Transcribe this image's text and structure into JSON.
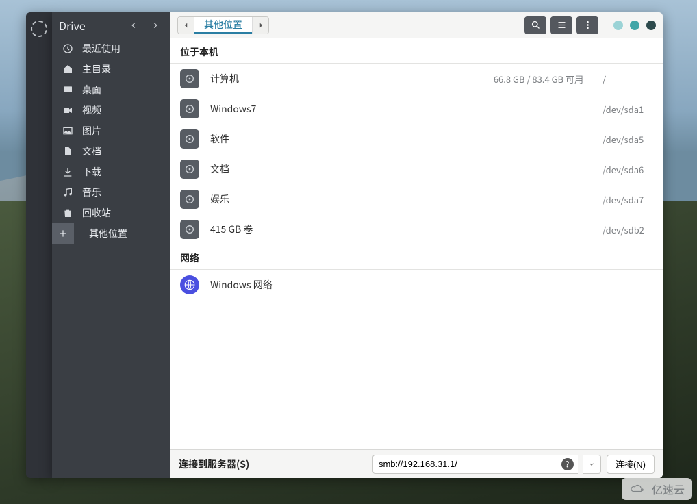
{
  "header": {
    "title": "Drive"
  },
  "path": {
    "current": "其他位置"
  },
  "sidebar": {
    "items": [
      {
        "label": "最近使用",
        "icon": "clock-icon"
      },
      {
        "label": "主目录",
        "icon": "home-icon"
      },
      {
        "label": "桌面",
        "icon": "desktop-icon"
      },
      {
        "label": "视频",
        "icon": "video-icon"
      },
      {
        "label": "图片",
        "icon": "image-icon"
      },
      {
        "label": "文档",
        "icon": "document-icon"
      },
      {
        "label": "下载",
        "icon": "download-icon"
      },
      {
        "label": "音乐",
        "icon": "music-icon"
      },
      {
        "label": "回收站",
        "icon": "trash-icon"
      }
    ],
    "other_label": "其他位置"
  },
  "sections": {
    "local_header": "位于本机",
    "network_header": "网络"
  },
  "volumes": [
    {
      "name": "计算机",
      "meta": "66.8 GB / 83.4 GB 可用",
      "path": "/"
    },
    {
      "name": "Windows7",
      "meta": "",
      "path": "/dev/sda1"
    },
    {
      "name": "软件",
      "meta": "",
      "path": "/dev/sda5"
    },
    {
      "name": "文档",
      "meta": "",
      "path": "/dev/sda6"
    },
    {
      "name": "娱乐",
      "meta": "",
      "path": "/dev/sda7"
    },
    {
      "name": "415 GB 卷",
      "meta": "",
      "path": "/dev/sdb2"
    }
  ],
  "network": [
    {
      "name": "Windows 网络"
    }
  ],
  "connect": {
    "label": "连接到服务器(S)",
    "value": "smb://192.168.31.1/",
    "button": "连接(N)"
  },
  "watermark": "亿速云"
}
